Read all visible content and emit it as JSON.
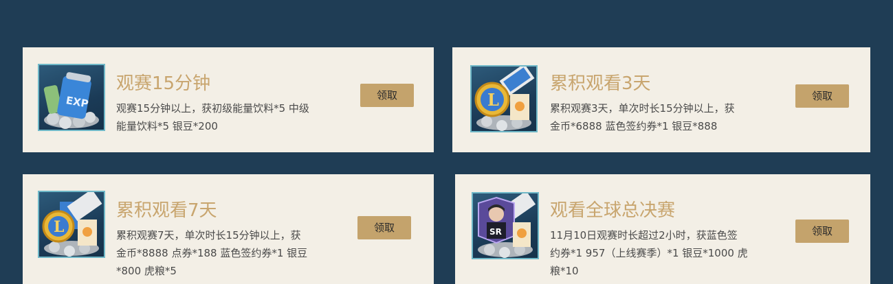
{
  "tasks": [
    {
      "title": "观赛15分钟",
      "description": "观赛15分钟以上，获初级能量饮料*5 中级\n能量饮料*5 银豆*200",
      "button_label": "领取",
      "icon": "exp-drink-can-icon"
    },
    {
      "title": "累积观看3天",
      "description": "累积观赛3天，单次时长15分钟以上，获\n金币*6888 蓝色签约券*1 银豆*888",
      "button_label": "领取",
      "icon": "lol-coin-ticket-icon"
    },
    {
      "title": "累积观看7天",
      "description": "累积观赛7天，单次时长15分钟以上，获\n金币*8888 点券*188 蓝色签约券*1 银豆\n*800 虎粮*5",
      "button_label": "领取",
      "icon": "lol-coin-ticket-icon"
    },
    {
      "title": "观看全球总决赛",
      "description": "11月10日观赛时长超过2小时，获蓝色签\n约券*1 957（上线赛季）*1 银豆*1000 虎\n粮*10",
      "button_label": "领取",
      "icon": "player-card-ticket-icon"
    }
  ],
  "colors": {
    "background": "#1f3d55",
    "card": "#f3efe6",
    "title": "#c8a56e",
    "button": "#c4a36c"
  }
}
